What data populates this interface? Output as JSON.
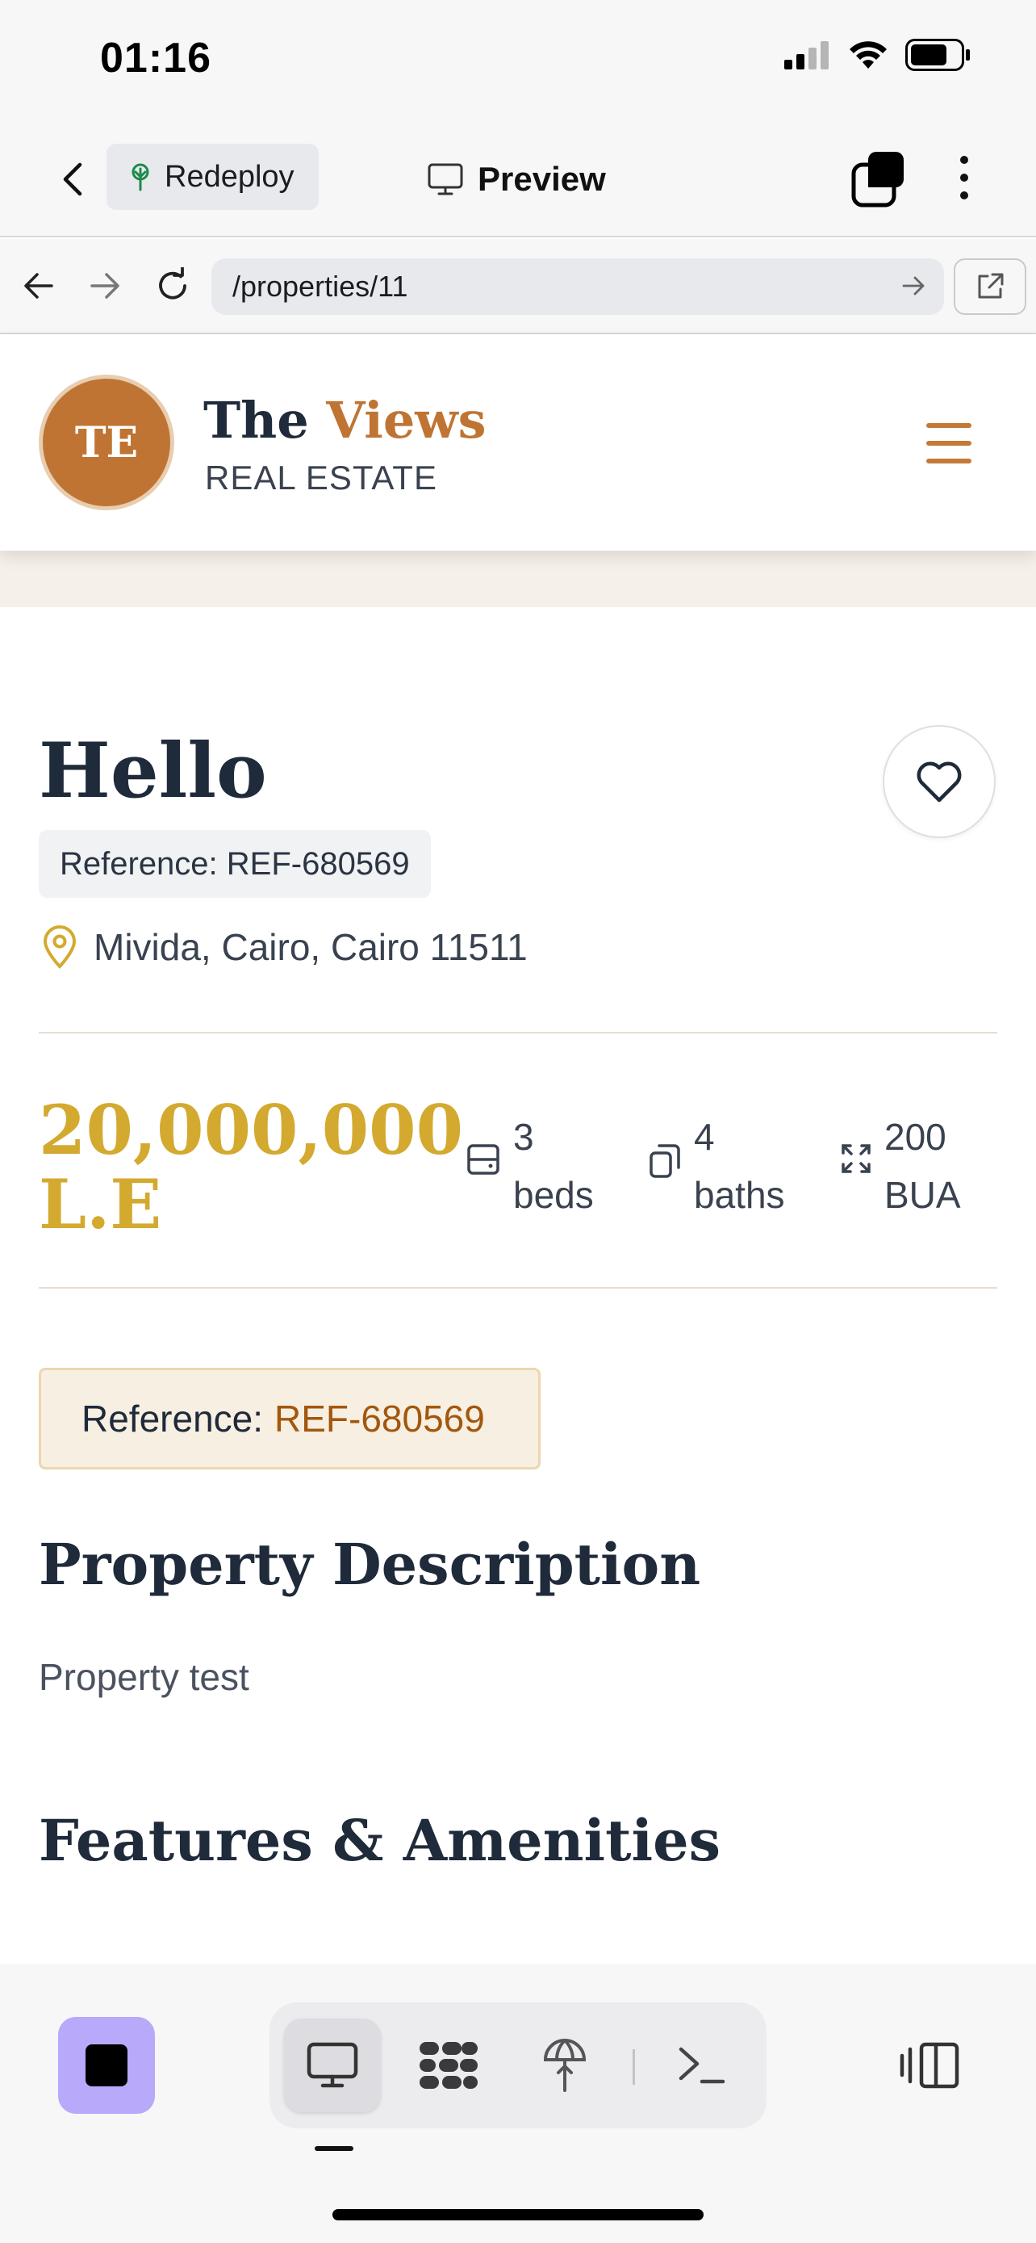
{
  "status_bar": {
    "time": "01:16"
  },
  "app_bar": {
    "redeploy_label": "Redeploy",
    "preview_label": "Preview"
  },
  "url_bar": {
    "url": "/properties/11"
  },
  "site_header": {
    "logo_initials": "TE",
    "brand_word1": "The",
    "brand_word2": "Views",
    "brand_sub": "REAL ESTATE",
    "accent_color": "#bf7433"
  },
  "property": {
    "title": "Hello",
    "reference_chip": "Reference: REF-680569",
    "location": "Mivida, Cairo, Cairo 11511",
    "price_line1": "20,000,000",
    "price_line2": "L.E",
    "beds_value": "3",
    "beds_label": "beds",
    "baths_value": "4",
    "baths_label": "baths",
    "area_value": "200",
    "area_label": "BUA",
    "reference_box_label": "Reference:",
    "reference_box_value": "REF-680569",
    "price_color": "#d3aa2f"
  },
  "sections": {
    "description_heading": "Property Description",
    "description_text": "Property test",
    "features_heading": "Features & Amenities"
  },
  "icons": {
    "back": "chevron-left-icon",
    "redeploy": "redeploy-tree-icon",
    "preview": "monitor-icon",
    "tabs": "tabs-icon",
    "more": "more-vertical-icon",
    "nav_back": "arrow-left-icon",
    "nav_forward": "arrow-right-icon",
    "reload": "reload-icon",
    "open_external": "external-link-icon",
    "favorite": "heart-icon",
    "location": "map-pin-icon",
    "beds": "bed-icon",
    "baths": "bath-icon",
    "area": "expand-icon",
    "stop": "stop-icon",
    "tool_preview": "monitor-icon",
    "tool_workspace": "workspace-icon",
    "tool_deploy": "deploy-icon",
    "tool_shell": "terminal-icon",
    "devices": "devices-icon"
  }
}
